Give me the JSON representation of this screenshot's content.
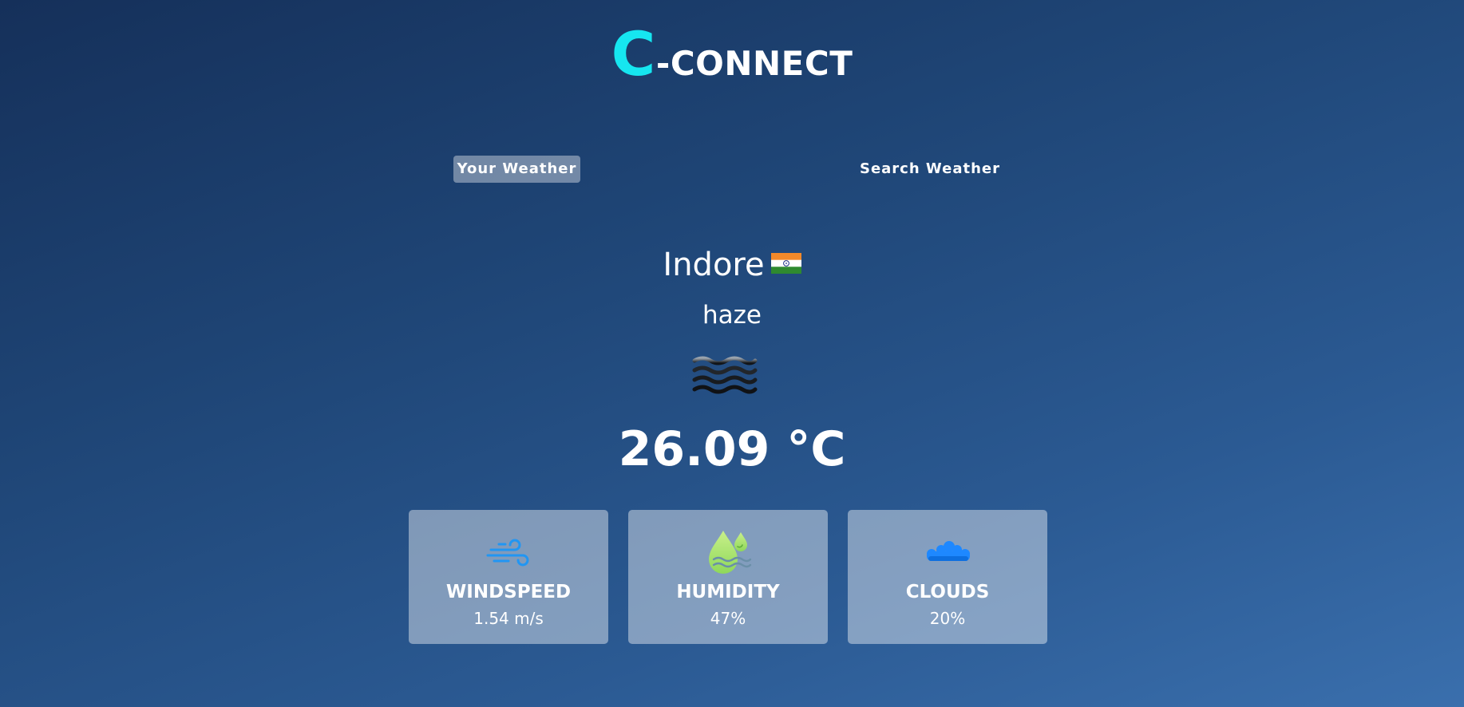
{
  "app": {
    "logo_letter": "C",
    "logo_rest": "-CONNECT",
    "accent_color": "#16e6f0"
  },
  "tabs": {
    "your_weather": "Your Weather",
    "search_weather": "Search Weather",
    "active": "your_weather"
  },
  "weather": {
    "city": "Indore",
    "country_flag_icon": "india-flag-icon",
    "condition": "haze",
    "condition_icon": "haze-icon",
    "temperature": "26.09 °C"
  },
  "cards": {
    "windspeed": {
      "label": "WINDSPEED",
      "value": "1.54 m/s",
      "icon": "wind-icon"
    },
    "humidity": {
      "label": "HUMIDITY",
      "value": "47%",
      "icon": "humidity-icon"
    },
    "clouds": {
      "label": "CLOUDS",
      "value": "20%",
      "icon": "clouds-icon"
    }
  }
}
